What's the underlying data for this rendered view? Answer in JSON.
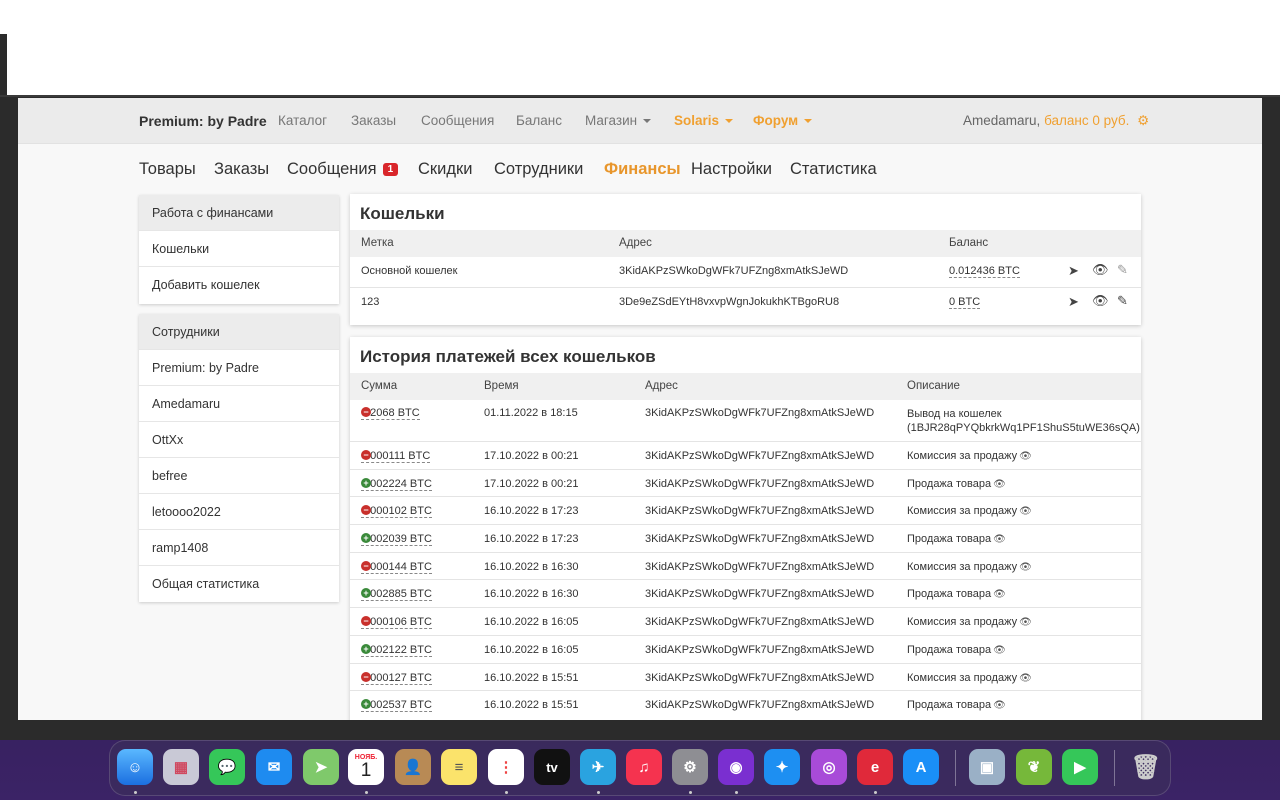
{
  "navbar": {
    "brand": "Premium: by Padre",
    "links": [
      "Каталог",
      "Заказы",
      "Сообщения",
      "Баланс"
    ],
    "shop": "Магазин",
    "solaris": "Solaris",
    "forum": "Форум",
    "username": "Amedamaru",
    "balance": "баланс 0 руб."
  },
  "subnav": {
    "items": [
      "Товары",
      "Заказы",
      "Сообщения",
      "Скидки",
      "Сотрудники",
      "Финансы",
      "Настройки",
      "Статистика"
    ],
    "messages_badge": "1"
  },
  "sidebar": {
    "finance_head": "Работа с финансами",
    "finance_items": [
      "Кошельки",
      "Добавить кошелек"
    ],
    "staff_head": "Сотрудники",
    "staff_items": [
      "Premium: by Padre",
      "Amedamaru",
      "OttXx",
      "befree",
      "letoooo2022",
      "ramp1408",
      "Общая статистика"
    ]
  },
  "wallets": {
    "title": "Кошельки",
    "columns": [
      "Метка",
      "Адрес",
      "Баланс"
    ],
    "rows": [
      {
        "label": "Основной кошелек",
        "address": "3KidAKPzSWkoDgWFk7UFZng8xmAtkSJeWD",
        "balance": "0.012436 BTC"
      },
      {
        "label": "123",
        "address": "3De9eZSdEYtH8vxvpWgnJokukhKTBgoRU8",
        "balance": "0 BTC"
      }
    ]
  },
  "history": {
    "title": "История платежей всех кошельков",
    "columns": [
      "Сумма",
      "Время",
      "Адрес",
      "Описание"
    ],
    "rows": [
      {
        "sign": "minus",
        "amount": "0.2068 BTC",
        "time": "01.11.2022 в 18:15",
        "address": "3KidAKPzSWkoDgWFk7UFZng8xmAtkSJeWD",
        "desc": "Вывод на кошелек",
        "desc2": "(1BJR28qPYQbkrkWq1PF1ShuS5tuWE36sQA)"
      },
      {
        "sign": "minus",
        "amount": "0.000111 BTC",
        "time": "17.10.2022 в 00:21",
        "address": "3KidAKPzSWkoDgWFk7UFZng8xmAtkSJeWD",
        "desc": "Комиссия за продажу"
      },
      {
        "sign": "plus",
        "amount": "0.002224 BTC",
        "time": "17.10.2022 в 00:21",
        "address": "3KidAKPzSWkoDgWFk7UFZng8xmAtkSJeWD",
        "desc": "Продажа товара"
      },
      {
        "sign": "minus",
        "amount": "0.000102 BTC",
        "time": "16.10.2022 в 17:23",
        "address": "3KidAKPzSWkoDgWFk7UFZng8xmAtkSJeWD",
        "desc": "Комиссия за продажу"
      },
      {
        "sign": "plus",
        "amount": "0.002039 BTC",
        "time": "16.10.2022 в 17:23",
        "address": "3KidAKPzSWkoDgWFk7UFZng8xmAtkSJeWD",
        "desc": "Продажа товара"
      },
      {
        "sign": "minus",
        "amount": "0.000144 BTC",
        "time": "16.10.2022 в 16:30",
        "address": "3KidAKPzSWkoDgWFk7UFZng8xmAtkSJeWD",
        "desc": "Комиссия за продажу"
      },
      {
        "sign": "plus",
        "amount": "0.002885 BTC",
        "time": "16.10.2022 в 16:30",
        "address": "3KidAKPzSWkoDgWFk7UFZng8xmAtkSJeWD",
        "desc": "Продажа товара"
      },
      {
        "sign": "minus",
        "amount": "0.000106 BTC",
        "time": "16.10.2022 в 16:05",
        "address": "3KidAKPzSWkoDgWFk7UFZng8xmAtkSJeWD",
        "desc": "Комиссия за продажу"
      },
      {
        "sign": "plus",
        "amount": "0.002122 BTC",
        "time": "16.10.2022 в 16:05",
        "address": "3KidAKPzSWkoDgWFk7UFZng8xmAtkSJeWD",
        "desc": "Продажа товара"
      },
      {
        "sign": "minus",
        "amount": "0.000127 BTC",
        "time": "16.10.2022 в 15:51",
        "address": "3KidAKPzSWkoDgWFk7UFZng8xmAtkSJeWD",
        "desc": "Комиссия за продажу"
      },
      {
        "sign": "plus",
        "amount": "0.002537 BTC",
        "time": "16.10.2022 в 15:51",
        "address": "3KidAKPzSWkoDgWFk7UFZng8xmAtkSJeWD",
        "desc": "Продажа товара"
      }
    ]
  },
  "dock": {
    "calendar_month": "НОЯБ.",
    "calendar_day": "1",
    "tv_label": "tv"
  },
  "colors": {
    "accent": "#f0a030",
    "active_tab": "#e8962c",
    "badge": "#d9262b",
    "minus": "#c9302c",
    "plus": "#3a8a3a"
  }
}
